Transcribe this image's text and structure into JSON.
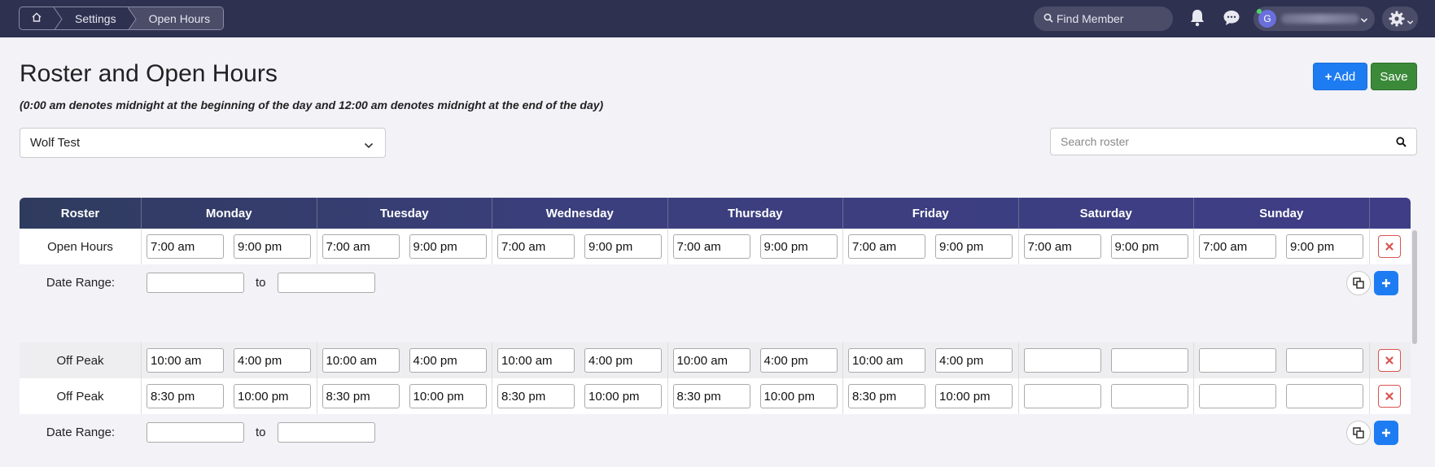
{
  "breadcrumb": {
    "home_icon": "home-icon",
    "items": [
      {
        "label": "Settings"
      },
      {
        "label": "Open Hours"
      }
    ]
  },
  "topbar": {
    "find_member_placeholder": "Find Member",
    "avatar_initial": "G",
    "icons": [
      "bell-icon",
      "chat-icon",
      "gear-icon"
    ]
  },
  "page": {
    "title": "Roster and Open Hours",
    "note": "(0:00 am denotes midnight at the beginning of the day and 12:00 am denotes midnight at the end of the day)",
    "add_label": "Add",
    "save_label": "Save",
    "selected_roster": "Wolf Test",
    "search_placeholder": "Search roster"
  },
  "table": {
    "headers": [
      "Roster",
      "Monday",
      "Tuesday",
      "Wednesday",
      "Thursday",
      "Friday",
      "Saturday",
      "Sunday"
    ],
    "date_range_label": "Date Range:",
    "to_label": "to",
    "groups": [
      {
        "rows": [
          {
            "name": "Open Hours",
            "times": [
              [
                "7:00 am",
                "9:00 pm"
              ],
              [
                "7:00 am",
                "9:00 pm"
              ],
              [
                "7:00 am",
                "9:00 pm"
              ],
              [
                "7:00 am",
                "9:00 pm"
              ],
              [
                "7:00 am",
                "9:00 pm"
              ],
              [
                "7:00 am",
                "9:00 pm"
              ],
              [
                "7:00 am",
                "9:00 pm"
              ]
            ]
          }
        ]
      },
      {
        "rows": [
          {
            "name": "Off Peak",
            "times": [
              [
                "10:00 am",
                "4:00 pm"
              ],
              [
                "10:00 am",
                "4:00 pm"
              ],
              [
                "10:00 am",
                "4:00 pm"
              ],
              [
                "10:00 am",
                "4:00 pm"
              ],
              [
                "10:00 am",
                "4:00 pm"
              ],
              [
                "",
                ""
              ],
              [
                "",
                ""
              ]
            ]
          },
          {
            "name": "Off Peak",
            "times": [
              [
                "8:30 pm",
                "10:00 pm"
              ],
              [
                "8:30 pm",
                "10:00 pm"
              ],
              [
                "8:30 pm",
                "10:00 pm"
              ],
              [
                "8:30 pm",
                "10:00 pm"
              ],
              [
                "8:30 pm",
                "10:00 pm"
              ],
              [
                "",
                ""
              ],
              [
                "",
                ""
              ]
            ]
          }
        ]
      }
    ]
  },
  "colors": {
    "topbar": "#2f3150",
    "primary": "#1e7cf2",
    "success": "#3b8a3a",
    "danger": "#d9534f"
  }
}
